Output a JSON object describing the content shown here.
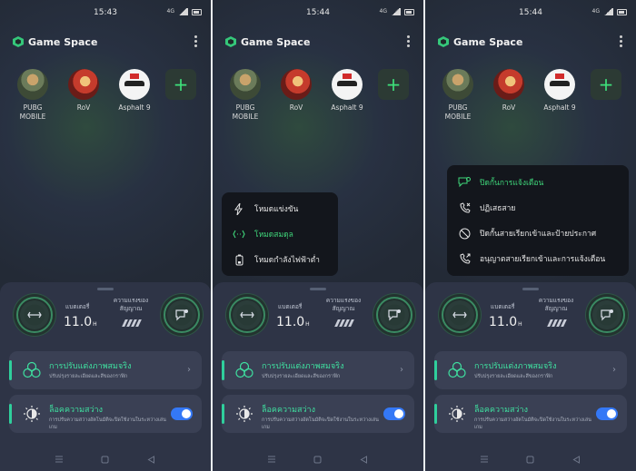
{
  "colors": {
    "accent_green": "#3fd67a",
    "toggle_blue": "#3478f6",
    "card_bg": "#3a4054",
    "sheet_bg": "#2e3446"
  },
  "panels": [
    {
      "time": "15:43",
      "app_title": "Game Space",
      "games": [
        {
          "name": "PUBG MOBILE",
          "icon": "pubg-icon"
        },
        {
          "name": "RoV",
          "icon": "rov-icon"
        },
        {
          "name": "Asphalt 9",
          "icon": "asphalt-icon"
        }
      ],
      "battery_label": "แบตเตอรี่",
      "battery_value": "11.0",
      "battery_unit": "H",
      "stability_label": "ความแรงของสัญญาณ",
      "card1_title": "การปรับแต่งภาพสมจริง",
      "card1_sub": "ปรับปรุงรายละเอียดและสีของกราฟิก",
      "card2_title": "ล็อคความสว่าง",
      "card2_sub": "การปรับความสว่างอัตโนมัติจะปิดใช้งานในระหว่างเล่นเกม"
    },
    {
      "time": "15:44",
      "app_title": "Game Space",
      "games": [
        {
          "name": "PUBG MOBILE",
          "icon": "pubg-icon"
        },
        {
          "name": "RoV",
          "icon": "rov-icon"
        },
        {
          "name": "Asphalt 9",
          "icon": "asphalt-icon"
        }
      ],
      "mode_menu": [
        {
          "label": "โหมดแข่งขัน",
          "icon": "lightning-icon",
          "active": false
        },
        {
          "label": "โหมดสมดุล",
          "icon": "balance-icon",
          "active": true
        },
        {
          "label": "โหมดกำลังไฟฟ้าต่ำ",
          "icon": "low-power-icon",
          "active": false
        }
      ],
      "battery_label": "แบตเตอรี่",
      "battery_value": "11.0",
      "battery_unit": "H",
      "stability_label": "ความแรงของสัญญาณ",
      "card1_title": "การปรับแต่งภาพสมจริง",
      "card1_sub": "ปรับปรุงรายละเอียดและสีของกราฟิก",
      "card2_title": "ล็อคความสว่าง",
      "card2_sub": "การปรับความสว่างอัตโนมัติจะปิดใช้งานในระหว่างเล่นเกม"
    },
    {
      "time": "15:44",
      "app_title": "Game Space",
      "games": [
        {
          "name": "PUBG MOBILE",
          "icon": "pubg-icon"
        },
        {
          "name": "RoV",
          "icon": "rov-icon"
        },
        {
          "name": "Asphalt 9",
          "icon": "asphalt-icon"
        }
      ],
      "notify_menu": [
        {
          "label": "ปิดกั้นการแจ้งเตือน",
          "icon": "block-notification-icon",
          "active": true
        },
        {
          "label": "ปฏิเสธสาย",
          "icon": "reject-call-icon",
          "active": false
        },
        {
          "label": "ปิดกั้นสายเรียกเข้าและป้ายประกาศ",
          "icon": "block-calls-icon",
          "active": false
        },
        {
          "label": "อนุญาตสายเรียกเข้าและการแจ้งเตือน",
          "icon": "allow-calls-icon",
          "active": false
        }
      ],
      "battery_label": "แบตเตอรี่",
      "battery_value": "11.0",
      "battery_unit": "H",
      "stability_label": "ความแรงของสัญญาณ",
      "card1_title": "การปรับแต่งภาพสมจริง",
      "card1_sub": "ปรับปรุงรายละเอียดและสีของกราฟิก",
      "card2_title": "ล็อคความสว่าง",
      "card2_sub": "การปรับความสว่างอัตโนมัติจะปิดใช้งานในระหว่างเล่นเกม"
    }
  ]
}
